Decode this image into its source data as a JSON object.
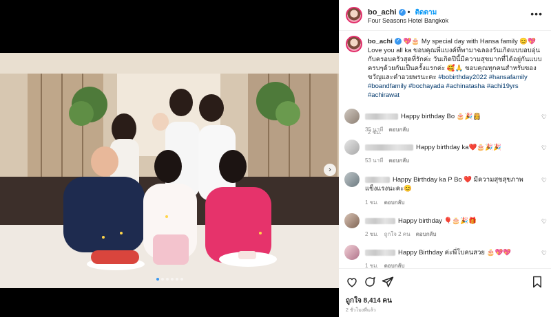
{
  "post": {
    "username": "bo_achi",
    "follow_label": "ติดตาม",
    "location": "Four Seasons Hotel Bangkok",
    "more_label": "•••"
  },
  "caption": {
    "username": "bo_achi",
    "line1": " 💖🎂 My special day with Hansa family 😊💖 Love you all ka ขอบคุณพี่แบงค์ที่พามาฉลองวันเกิดแบบอบอุ่นกับครอบครัวสุดที่รักค่ะ วันเกิดปีนี้มีความสุขมากที่ได้อยู่กันแบบครบๆด้วยกันเป็นครั้งแรกค่ะ 🥰🙏 ขอบคุณทุกคนสำหรับของขวัญและคำอวยพรนะคะ",
    "tags": "#bobirthday2022 #hansafamily #boandfamily #bochayada #achinatasha #achi19yrs #achirawat",
    "time": "2 ชม."
  },
  "comments": [
    {
      "text": "Happy birthday Bo 🎂🎉👸",
      "time": "35 นาที",
      "likes": "",
      "reply": "ตอบกลับ"
    },
    {
      "text": "Happy birthday ka❤️🎂🎉🎉",
      "time": "53 นาที",
      "likes": "",
      "reply": "ตอบกลับ"
    },
    {
      "text": "Happy Birthday ka P Bo ❤️ มีความสุขสุขภาพแข็งแรงนะคะ😊",
      "time": "1 ชม.",
      "likes": "",
      "reply": "ตอบกลับ"
    },
    {
      "text": "Happy birthday 🎈🎂🎉🎁",
      "time": "2 ชม.",
      "likes": "ถูกใจ 2 คน",
      "reply": "ตอบกลับ"
    },
    {
      "text": "Happy Birthday ค่ะพี่โบคนสวย 🎂💖💖",
      "time": "1 ชม.",
      "likes": "",
      "reply": "ตอบกลับ"
    }
  ],
  "stats": {
    "likes": "ถูกใจ 8,414 คน",
    "posted_ago": "2 ชั่วโมงที่แล้ว"
  },
  "carousel": {
    "count": 6,
    "active": 0
  },
  "icons": [
    "verified-icon",
    "more-icon",
    "heart-icon",
    "comment-icon",
    "share-icon",
    "bookmark-icon",
    "next-icon"
  ],
  "colors": {
    "accent": "#0095f6",
    "hashtag": "#00376b",
    "muted": "#8e8e8e"
  }
}
